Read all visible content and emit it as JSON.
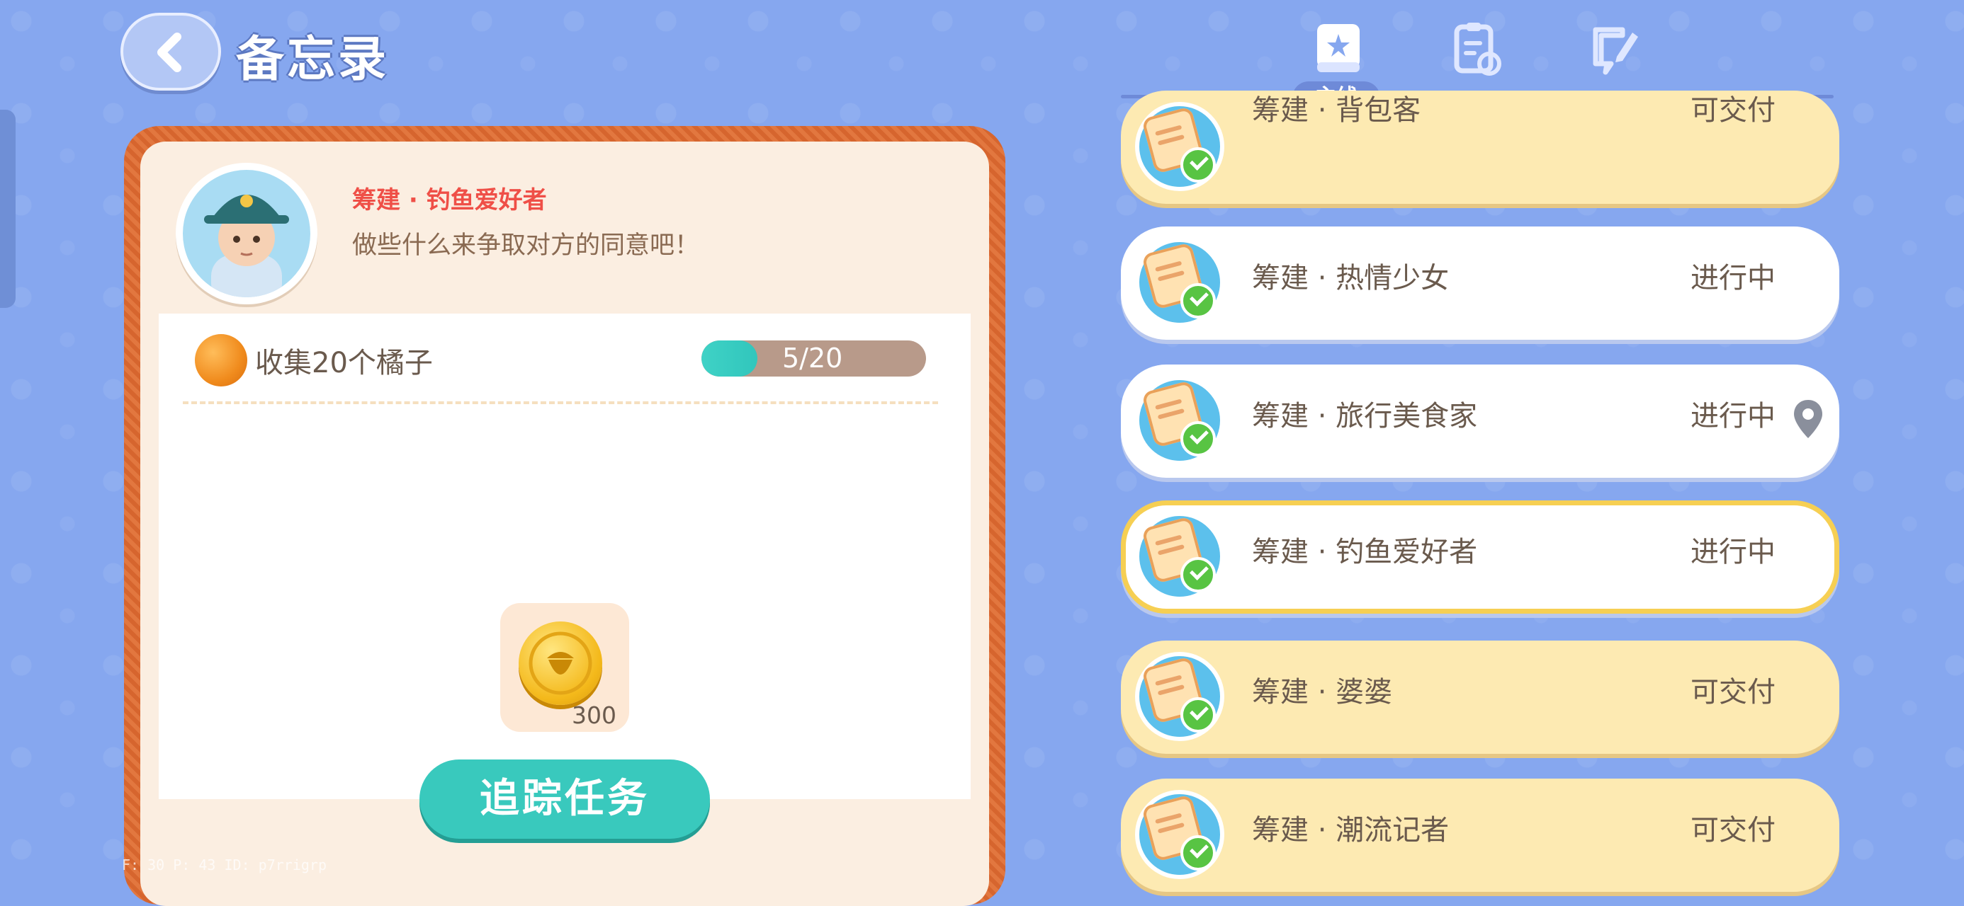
{
  "header": {
    "title": "备忘录"
  },
  "tabs": [
    {
      "icon": "book-star-icon",
      "label": "主线",
      "active": true
    },
    {
      "icon": "clipboard-refresh-icon",
      "label": "",
      "active": false
    },
    {
      "icon": "note-edit-icon",
      "label": "",
      "active": false
    }
  ],
  "detail": {
    "npc_name": "筹建 · 钓鱼爱好者",
    "npc_desc": "做些什么来争取对方的同意吧！",
    "task_text": "收集20个橘子",
    "progress_text": "5/20",
    "progress_fraction": 0.25,
    "reward_amount": "300",
    "track_button": "追踪任务"
  },
  "quests": [
    {
      "name": "筹建 · 背包客",
      "status": "可交付"
    },
    {
      "name": "筹建 · 热情少女",
      "status": "进行中"
    },
    {
      "name": "筹建 · 旅行美食家",
      "status": "进行中"
    },
    {
      "name": "筹建 · 钓鱼爱好者",
      "status": "进行中"
    },
    {
      "name": "筹建 · 婆婆",
      "status": "可交付"
    },
    {
      "name": "筹建 · 潮流记者",
      "status": "可交付"
    }
  ],
  "debug": "F: 30     P: 43     ID: p7rrigrp",
  "colors": {
    "background": "#86a7ef",
    "accent": "#39c9bd",
    "deliverable": "#fdeab2",
    "selected_border": "#f6cf53"
  }
}
